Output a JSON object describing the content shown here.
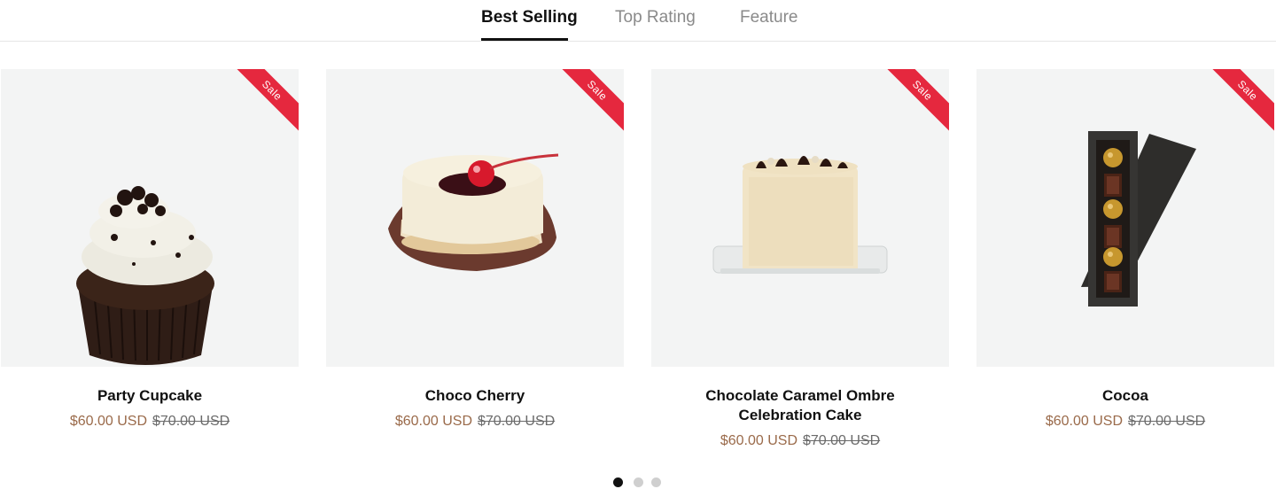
{
  "tabs": [
    {
      "label": "Best Selling",
      "active": true
    },
    {
      "label": "Top Rating",
      "active": false
    },
    {
      "label": "Feature",
      "active": false
    }
  ],
  "products": [
    {
      "name": "Party Cupcake",
      "badge": "Sale",
      "price": "$60.00 USD",
      "compare_price": "$70.00 USD",
      "image_icon": "cupcake-image"
    },
    {
      "name": "Choco Cherry",
      "badge": "Sale",
      "price": "$60.00 USD",
      "compare_price": "$70.00 USD",
      "image_icon": "cherry-tart-image"
    },
    {
      "name": "Chocolate Caramel Ombre Celebration Cake",
      "badge": "Sale",
      "price": "$60.00 USD",
      "compare_price": "$70.00 USD",
      "image_icon": "cake-image"
    },
    {
      "name": "Cocoa",
      "badge": "Sale",
      "price": "$60.00 USD",
      "compare_price": "$70.00 USD",
      "image_icon": "chocolate-box-image"
    }
  ],
  "pagination": {
    "count": 3,
    "active_index": 0
  },
  "colors": {
    "badge": "#e5283e",
    "price": "#9a6a4a",
    "dot_active": "#111111",
    "dot_inactive": "#cfcfcf"
  }
}
